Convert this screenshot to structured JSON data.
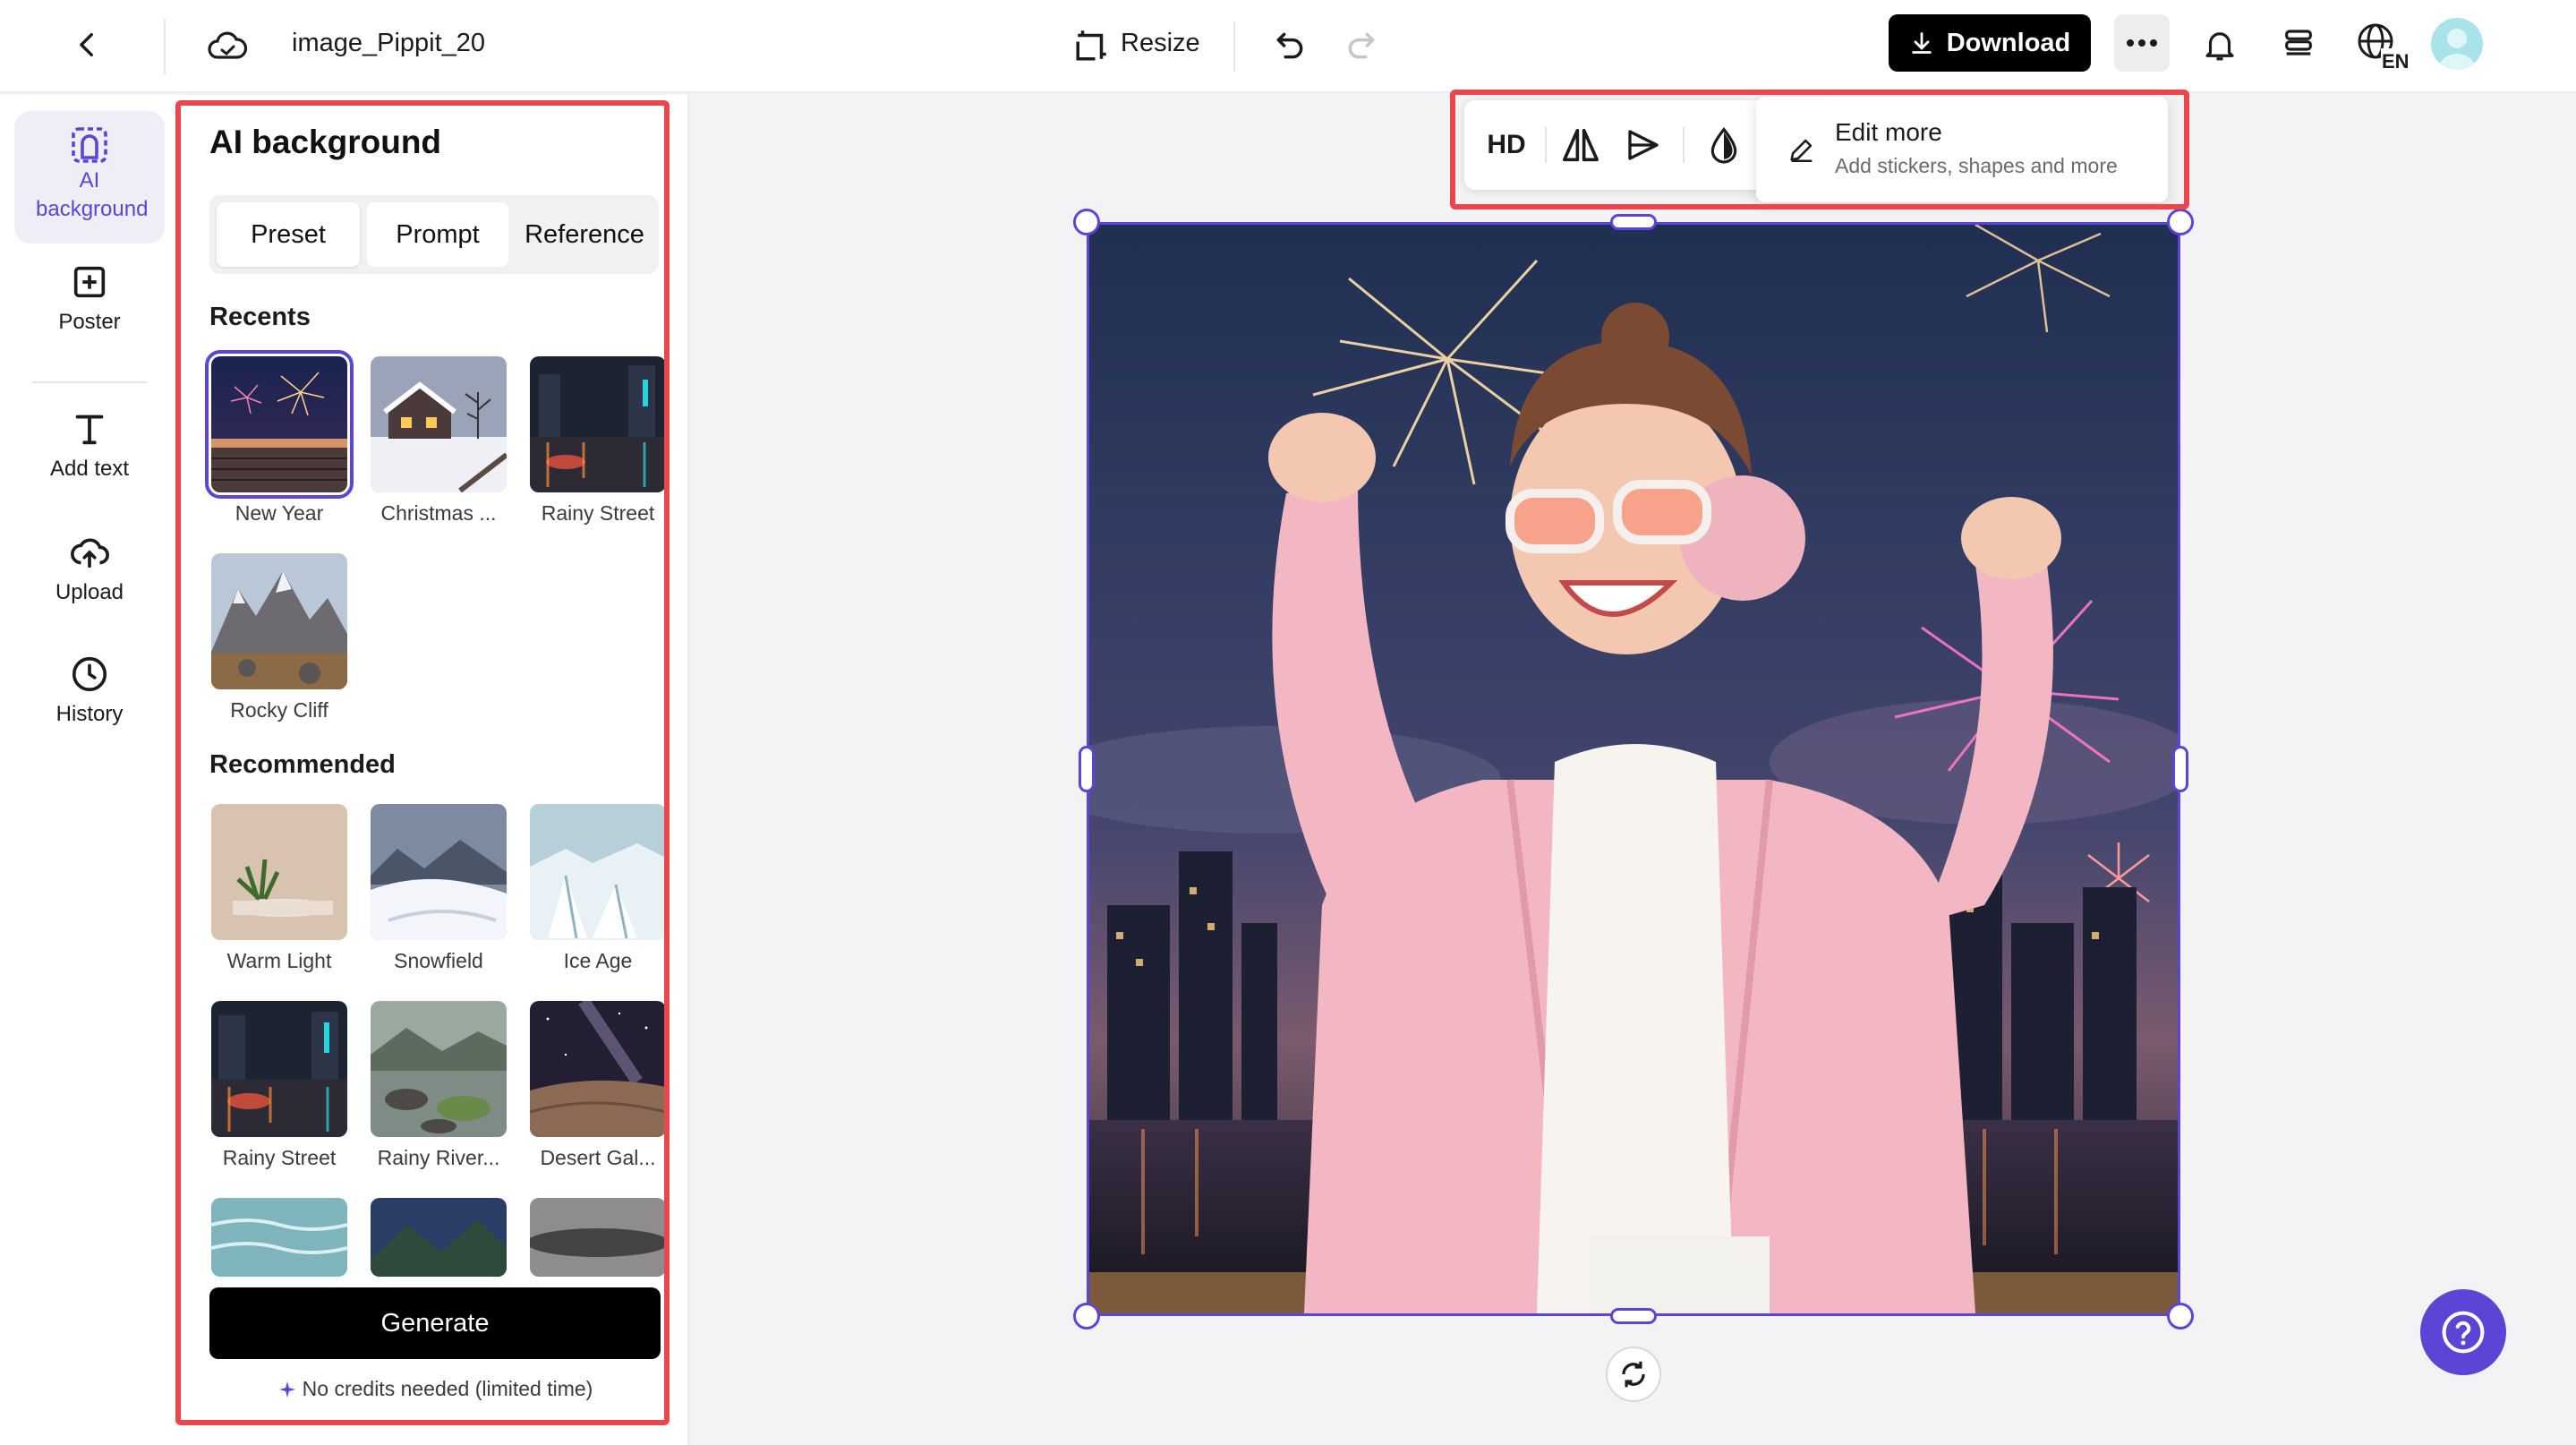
{
  "header": {
    "file_name": "image_Pippit_20",
    "resize_label": "Resize",
    "download_label": "Download",
    "language_code": "EN"
  },
  "rail": {
    "items": [
      {
        "label": "AI background",
        "icon": "ai-background-icon",
        "active": true
      },
      {
        "label": "Poster",
        "icon": "poster-icon"
      },
      {
        "label": "Add text",
        "icon": "text-icon"
      },
      {
        "label": "Upload",
        "icon": "upload-icon"
      },
      {
        "label": "History",
        "icon": "history-icon"
      }
    ]
  },
  "panel": {
    "title": "AI background",
    "tabs": [
      "Preset",
      "Prompt",
      "Reference"
    ],
    "selected_tab": "Preset",
    "recents_heading": "Recents",
    "recents": [
      "New Year",
      "Christmas ...",
      "Rainy Street",
      "Rocky Cliff"
    ],
    "recommended_heading": "Recommended",
    "recommended": [
      "Warm Light",
      "Snowfield",
      "Ice Age",
      "Rainy Street",
      "Rainy River...",
      "Desert Gal..."
    ],
    "generate_label": "Generate",
    "credits_note": "No credits needed (limited time)"
  },
  "toolbar": {
    "hd_label": "HD",
    "edit_more_title": "Edit more",
    "edit_more_subtitle": "Add stickers, shapes and more"
  },
  "colors": {
    "accent": "#5b45d6",
    "highlight_frame": "#e8474b",
    "primary_button": "#000000"
  }
}
